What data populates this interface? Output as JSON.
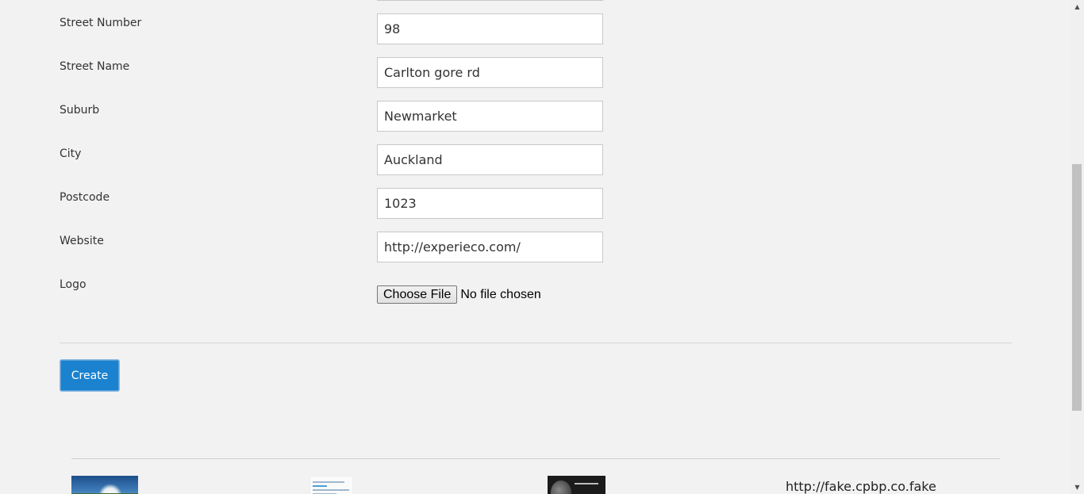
{
  "form": {
    "fields": [
      {
        "label": "Street Number",
        "value": "98"
      },
      {
        "label": "Street Name",
        "value": "Carlton gore rd"
      },
      {
        "label": "Suburb",
        "value": "Newmarket"
      },
      {
        "label": "City",
        "value": "Auckland"
      },
      {
        "label": "Postcode",
        "value": "1023"
      },
      {
        "label": "Website",
        "value": "http://experieco.com/"
      }
    ],
    "logo": {
      "label": "Logo",
      "button_label": "Choose File",
      "status": "No file chosen"
    },
    "create_label": "Create"
  },
  "footer": {
    "link_text": "http://fake.cpbp.co.fake"
  },
  "scrollbar": {
    "up_icon": "▲",
    "down_icon": "▼"
  },
  "colors": {
    "background": "#f2f2f2",
    "primary_button": "#1a82cf"
  }
}
